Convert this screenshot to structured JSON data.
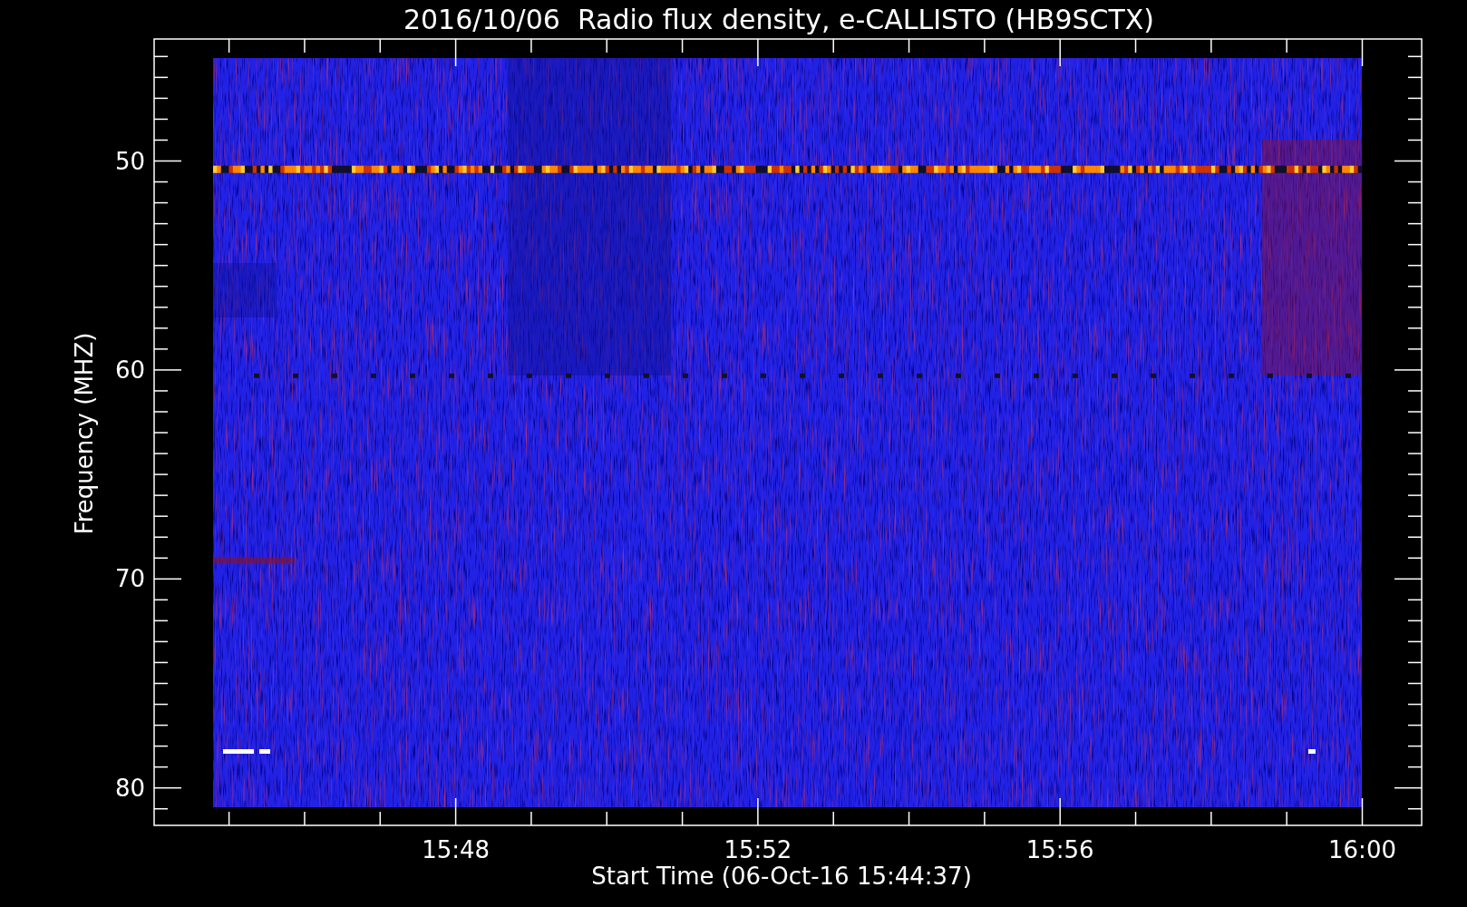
{
  "title": "2016/10/06  Radio flux density, e-CALLISTO (HB9SCTX)",
  "y_axis": {
    "label": "Frequency (MHZ)",
    "ticks": [
      "50",
      "60",
      "70",
      "80"
    ]
  },
  "x_axis": {
    "label": "Start Time (06-Oct-16 15:44:37)",
    "ticks": [
      "15:48",
      "15:52",
      "15:56",
      "16:00"
    ]
  }
}
